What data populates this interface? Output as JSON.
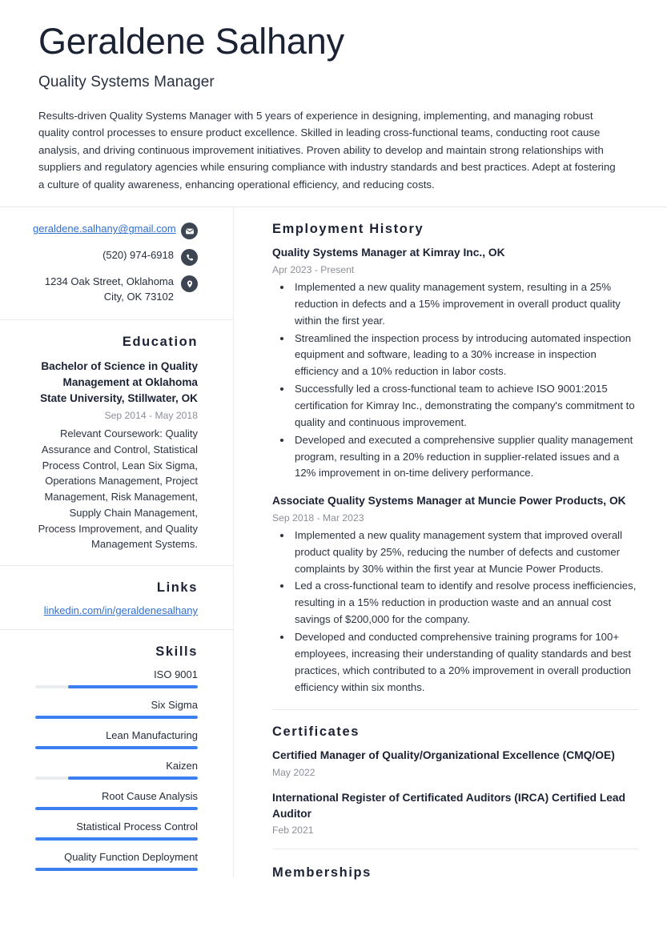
{
  "header": {
    "name": "Geraldene Salhany",
    "title": "Quality Systems Manager",
    "summary": "Results-driven Quality Systems Manager with 5 years of experience in designing, implementing, and managing robust quality control processes to ensure product excellence. Skilled in leading cross-functional teams, conducting root cause analysis, and driving continuous improvement initiatives. Proven ability to develop and maintain strong relationships with suppliers and regulatory agencies while ensuring compliance with industry standards and best practices. Adept at fostering a culture of quality awareness, enhancing operational efficiency, and reducing costs."
  },
  "contact": {
    "email": "geraldene.salhany@gmail.com",
    "phone": "(520) 974-6918",
    "address": "1234 Oak Street, Oklahoma City, OK 73102",
    "icons": {
      "email": "envelope-icon",
      "phone": "phone-icon",
      "address": "location-pin-icon"
    }
  },
  "education": {
    "heading": "Education",
    "degree": "Bachelor of Science in Quality Management at Oklahoma State University, Stillwater, OK",
    "date": "Sep 2014 - May 2018",
    "description": "Relevant Coursework: Quality Assurance and Control, Statistical Process Control, Lean Six Sigma, Operations Management, Project Management, Risk Management, Supply Chain Management, Process Improvement, and Quality Management Systems."
  },
  "links": {
    "heading": "Links",
    "items": [
      {
        "label": "linkedin.com/in/geraldenesalhany"
      }
    ]
  },
  "skills": {
    "heading": "Skills",
    "items": [
      {
        "name": "ISO 9001",
        "level": 80
      },
      {
        "name": "Six Sigma",
        "level": 100
      },
      {
        "name": "Lean Manufacturing",
        "level": 100
      },
      {
        "name": "Kaizen",
        "level": 80
      },
      {
        "name": "Root Cause Analysis",
        "level": 100
      },
      {
        "name": "Statistical Process Control",
        "level": 100
      },
      {
        "name": "Quality Function Deployment",
        "level": 100
      }
    ]
  },
  "employment": {
    "heading": "Employment History",
    "entries": [
      {
        "title": "Quality Systems Manager at Kimray Inc., OK",
        "date": "Apr 2023 - Present",
        "bullets": [
          "Implemented a new quality management system, resulting in a 25% reduction in defects and a 15% improvement in overall product quality within the first year.",
          "Streamlined the inspection process by introducing automated inspection equipment and software, leading to a 30% increase in inspection efficiency and a 10% reduction in labor costs.",
          "Successfully led a cross-functional team to achieve ISO 9001:2015 certification for Kimray Inc., demonstrating the company's commitment to quality and continuous improvement.",
          "Developed and executed a comprehensive supplier quality management program, resulting in a 20% reduction in supplier-related issues and a 12% improvement in on-time delivery performance."
        ]
      },
      {
        "title": "Associate Quality Systems Manager at Muncie Power Products, OK",
        "date": "Sep 2018 - Mar 2023",
        "bullets": [
          "Implemented a new quality management system that improved overall product quality by 25%, reducing the number of defects and customer complaints by 30% within the first year at Muncie Power Products.",
          "Led a cross-functional team to identify and resolve process inefficiencies, resulting in a 15% reduction in production waste and an annual cost savings of $200,000 for the company.",
          "Developed and conducted comprehensive training programs for 100+ employees, increasing their understanding of quality standards and best practices, which contributed to a 20% improvement in overall production efficiency within six months."
        ]
      }
    ]
  },
  "certificates": {
    "heading": "Certificates",
    "entries": [
      {
        "title": "Certified Manager of Quality/Organizational Excellence (CMQ/OE)",
        "date": "May 2022"
      },
      {
        "title": "International Register of Certificated Auditors (IRCA) Certified Lead Auditor",
        "date": "Feb 2021"
      }
    ]
  },
  "memberships": {
    "heading": "Memberships"
  },
  "colors": {
    "accent_blue": "#3b7ff0",
    "link_blue": "#2f6fd0",
    "icon_circle": "#3d4553",
    "heading": "#1b2233",
    "muted": "#8b8f98"
  }
}
